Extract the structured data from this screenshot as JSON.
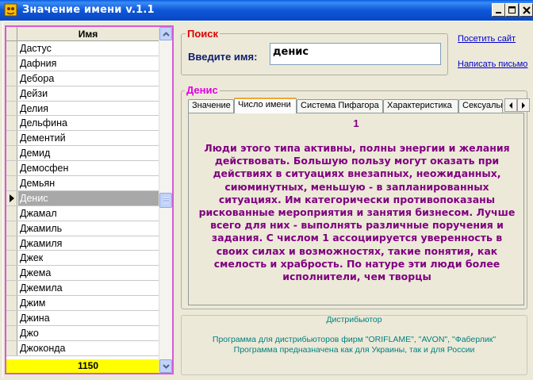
{
  "window": {
    "title": "Значение имени v.1.1"
  },
  "grid": {
    "column_header": "Имя",
    "rows": [
      "Дастус",
      "Дафния",
      "Дебора",
      "Дейзи",
      "Делия",
      "Дельфина",
      "Дементий",
      "Демид",
      "Демосфен",
      "Демьян",
      "Денис",
      "Джамал",
      "Джамиль",
      "Джамиля",
      "Джек",
      "Джема",
      "Джемила",
      "Джим",
      "Джина",
      "Джо",
      "Джоконда"
    ],
    "selected_index": 10,
    "footer_count": "1150"
  },
  "search": {
    "group_label": "Поиск",
    "prompt_label": "Введите имя:",
    "input_value": "денис"
  },
  "links": {
    "site": "Посетить сайт",
    "mail": "Написать письмо"
  },
  "result": {
    "group_label": "Денис",
    "tabs": [
      "Значение",
      "Число имени",
      "Система Пифагора",
      "Характеристика",
      "Сексуальность"
    ],
    "active_tab_index": 1,
    "number": "1",
    "text": "Люди этого типа активны, полны энергии и желания действовать. Большую пользу могут оказать при действиях в ситуациях внезапных, неожиданных, сиюминутных, меньшую - в запланированных ситуациях. Им категорически противопоказаны рискованные мероприятия и занятия бизнесом. Лучше всего для них - выполнять различные поручения и задания. С числом 1 ассоциируется уверенность в своих силах и возможностях, такие понятия, как смелость и храбрость. По натуре эти люди более исполнители, чем творцы"
  },
  "info": {
    "line1": "Дистрибьютор",
    "line2": "Программа для дистрибьюторов фирм \"ORIFLAME\", \"AVON\", \"Фаберлик\"",
    "line3": "Программа предназначена как для Украины, так и для России"
  },
  "icons": [
    "app-icon",
    "minimize-icon",
    "maximize-icon",
    "close-icon",
    "scroll-up-icon",
    "scroll-down-icon",
    "row-pointer-icon",
    "tab-left-icon",
    "tab-right-icon"
  ],
  "colors": {
    "titlebar": "#0A5DE0",
    "window_bg": "#ECE9D8",
    "selection": "#A8A8A8",
    "footer": "#FFFF00",
    "search_label": "#E00000",
    "result_label": "#E000E0",
    "result_text": "#800080",
    "link": "#0000CC",
    "info_text": "#008080",
    "grid_border": "#D65AD6"
  }
}
